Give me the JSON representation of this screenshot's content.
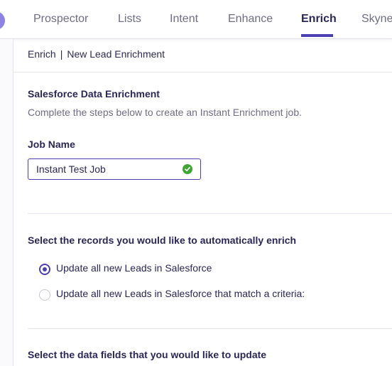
{
  "nav": {
    "tabs": [
      {
        "label": "Prospector",
        "active": false
      },
      {
        "label": "Lists",
        "active": false
      },
      {
        "label": "Intent",
        "active": false
      },
      {
        "label": "Enhance",
        "active": false
      },
      {
        "label": "Enrich",
        "active": true
      },
      {
        "label": "Skyne",
        "active": false
      }
    ],
    "accent_color": "#4b3fb3"
  },
  "breadcrumb": {
    "root": "Enrich",
    "separator": "|",
    "current": "New Lead Enrichment"
  },
  "header": {
    "title": "Salesforce Data Enrichment",
    "subtitle": "Complete the steps below to create an Instant Enrichment job."
  },
  "job_name": {
    "label": "Job Name",
    "value": "Instant Test Job",
    "valid": true,
    "status_icon": "check-circle-icon",
    "status_color": "#3fa535"
  },
  "records": {
    "title": "Select the records you would like to automatically enrich",
    "options": [
      {
        "label": "Update all new Leads in Salesforce",
        "selected": true
      },
      {
        "label": "Update all new Leads in Salesforce that match a criteria:",
        "selected": false
      }
    ]
  },
  "fields": {
    "title": "Select the data fields that you would like to update"
  }
}
